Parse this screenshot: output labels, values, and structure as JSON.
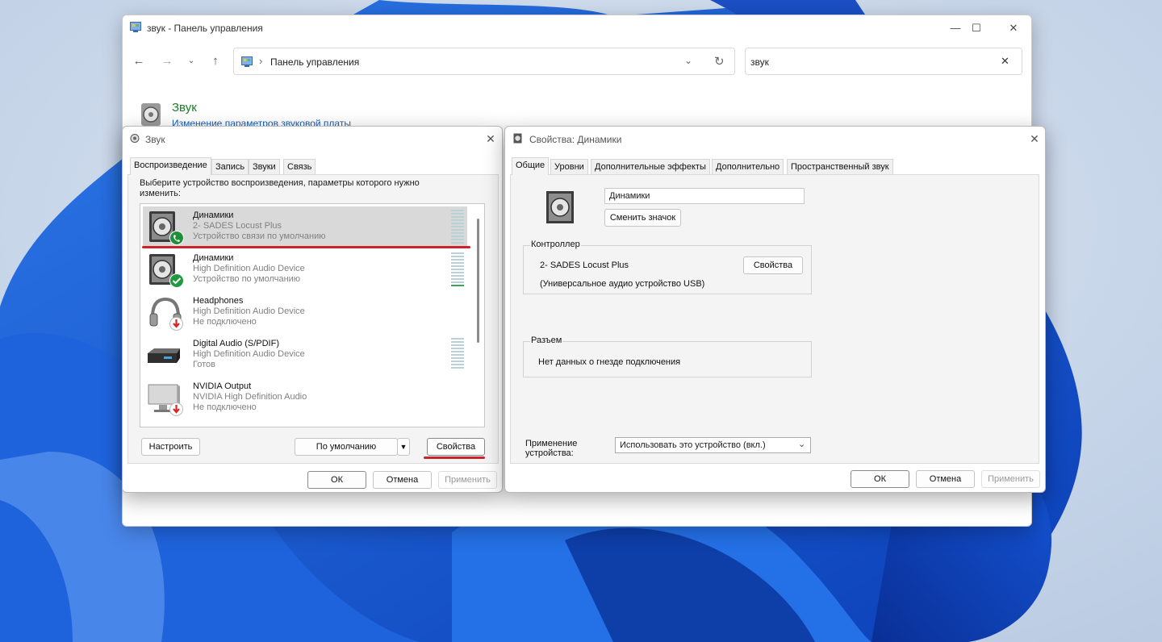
{
  "control_panel": {
    "window_title": "звук - Панель управления",
    "address_text": "Панель управления",
    "search_value": "звук",
    "item_title": "Звук",
    "item_link": "Изменение параметров звуковой платы"
  },
  "sound_dialog": {
    "title": "Звук",
    "tabs": [
      "Воспроизведение",
      "Запись",
      "Звуки",
      "Связь"
    ],
    "instruction": "Выберите устройство воспроизведения, параметры которого нужно изменить:",
    "devices": [
      {
        "name": "Динамики",
        "sub": "2- SADES Locust Plus",
        "status": "Устройство связи по умолчанию",
        "icon": "speaker-icon",
        "badge": "phone-badge-icon",
        "selected": true
      },
      {
        "name": "Динамики",
        "sub": "High Definition Audio Device",
        "status": "Устройство по умолчанию",
        "icon": "speaker-icon",
        "badge": "check-badge-icon",
        "selected": false
      },
      {
        "name": "Headphones",
        "sub": "High Definition Audio Device",
        "status": "Не подключено",
        "icon": "headphones-icon",
        "badge": "down-arrow-badge-icon",
        "selected": false
      },
      {
        "name": "Digital Audio (S/PDIF)",
        "sub": "High Definition Audio Device",
        "status": "Готов",
        "icon": "spdif-device-icon",
        "badge": "",
        "selected": false
      },
      {
        "name": "NVIDIA Output",
        "sub": "NVIDIA High Definition Audio",
        "status": "Не подключено",
        "icon": "monitor-icon",
        "badge": "down-arrow-badge-icon",
        "selected": false
      }
    ],
    "configure_label": "Настроить",
    "default_label": "По умолчанию",
    "properties_label": "Свойства",
    "ok_label": "ОК",
    "cancel_label": "Отмена",
    "apply_label": "Применить"
  },
  "properties_dialog": {
    "title": "Свойства: Динамики",
    "tabs": [
      "Общие",
      "Уровни",
      "Дополнительные эффекты",
      "Дополнительно",
      "Пространственный звук"
    ],
    "device_name_value": "Динамики",
    "change_icon_label": "Сменить значок",
    "controller_label": "Контроллер",
    "controller_name": "2- SADES Locust Plus",
    "controller_desc": "(Универсальное аудио устройство USB)",
    "controller_properties_label": "Свойства",
    "jack_label": "Разъем",
    "jack_info": "Нет данных о гнезде подключения",
    "usage_label_line1": "Применение",
    "usage_label_line2": "устройства:",
    "usage_value": "Использовать это устройство (вкл.)",
    "ok_label": "ОК",
    "cancel_label": "Отмена",
    "apply_label": "Применить"
  }
}
